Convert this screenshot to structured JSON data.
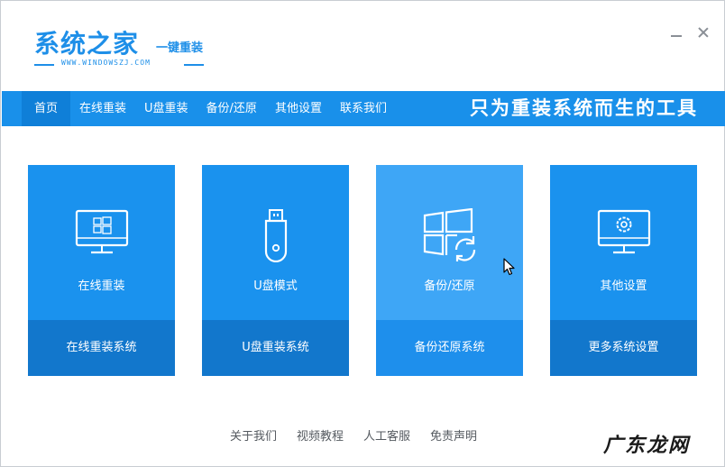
{
  "app": {
    "logo_main": "系统之家",
    "logo_sub": "一键重装",
    "logo_url": "WWW.WINDOWSZJ.COM",
    "brand_color": "#1990ea"
  },
  "window_controls": {
    "minimize_icon": "minimize-icon",
    "close_icon": "close-icon"
  },
  "nav": {
    "items": [
      {
        "label": "首页",
        "active": true
      },
      {
        "label": "在线重装",
        "active": false
      },
      {
        "label": "U盘重装",
        "active": false
      },
      {
        "label": "备份/还原",
        "active": false
      },
      {
        "label": "其他设置",
        "active": false
      },
      {
        "label": "联系我们",
        "active": false
      }
    ],
    "slogan": "只为重装系统而生的工具"
  },
  "cards": [
    {
      "icon": "monitor-windows-icon",
      "title": "在线重装",
      "action": "在线重装系统"
    },
    {
      "icon": "usb-drive-icon",
      "title": "U盘模式",
      "action": "U盘重装系统"
    },
    {
      "icon": "windows-restore-icon",
      "title": "备份/还原",
      "action": "备份还原系统"
    },
    {
      "icon": "monitor-gear-icon",
      "title": "其他设置",
      "action": "更多系统设置"
    }
  ],
  "footer": {
    "links": [
      "关于我们",
      "视频教程",
      "人工客服",
      "免责声明"
    ]
  },
  "watermark": "广东龙网"
}
